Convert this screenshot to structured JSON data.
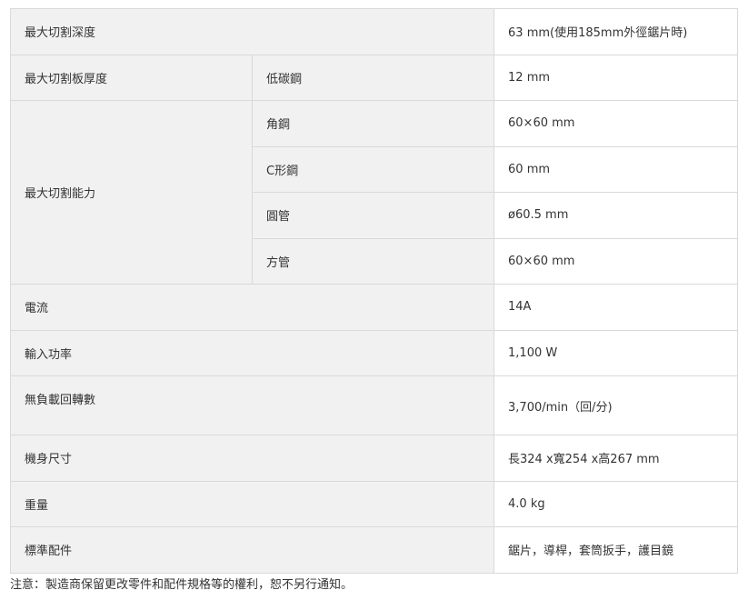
{
  "specs": {
    "max_cut_depth": {
      "label": "最大切割深度",
      "value": "63 mm(使用185mm外徑鋸片時)"
    },
    "max_cut_plate": {
      "label": "最大切割板厚度",
      "sub": "低碳鋼",
      "value": "12 mm"
    },
    "max_cut_capacity": {
      "label": "最大切割能力",
      "rows": [
        {
          "sub": "角鋼",
          "value": "60×60 mm"
        },
        {
          "sub": "C形鋼",
          "value": "60 mm"
        },
        {
          "sub": "圓管",
          "value": "ø60.5 mm"
        },
        {
          "sub": "方管",
          "value": "60×60 mm"
        }
      ]
    },
    "current": {
      "label": "電流",
      "value": "14A"
    },
    "input_power": {
      "label": "輸入功率",
      "value": "1,100 W"
    },
    "no_load_speed": {
      "label": "無負載回轉數",
      "value": "3,700/min（回/分)"
    },
    "dimensions": {
      "label": "機身尺寸",
      "value": "長324 x寬254 x高267 mm"
    },
    "weight": {
      "label": "重量",
      "value": "4.0 kg"
    },
    "accessories": {
      "label": "標準配件",
      "value": "鋸片，導桿，套筒扳手，護目鏡"
    }
  },
  "note": "注意：製造商保留更改零件和配件規格等的權利，恕不另行通知。"
}
